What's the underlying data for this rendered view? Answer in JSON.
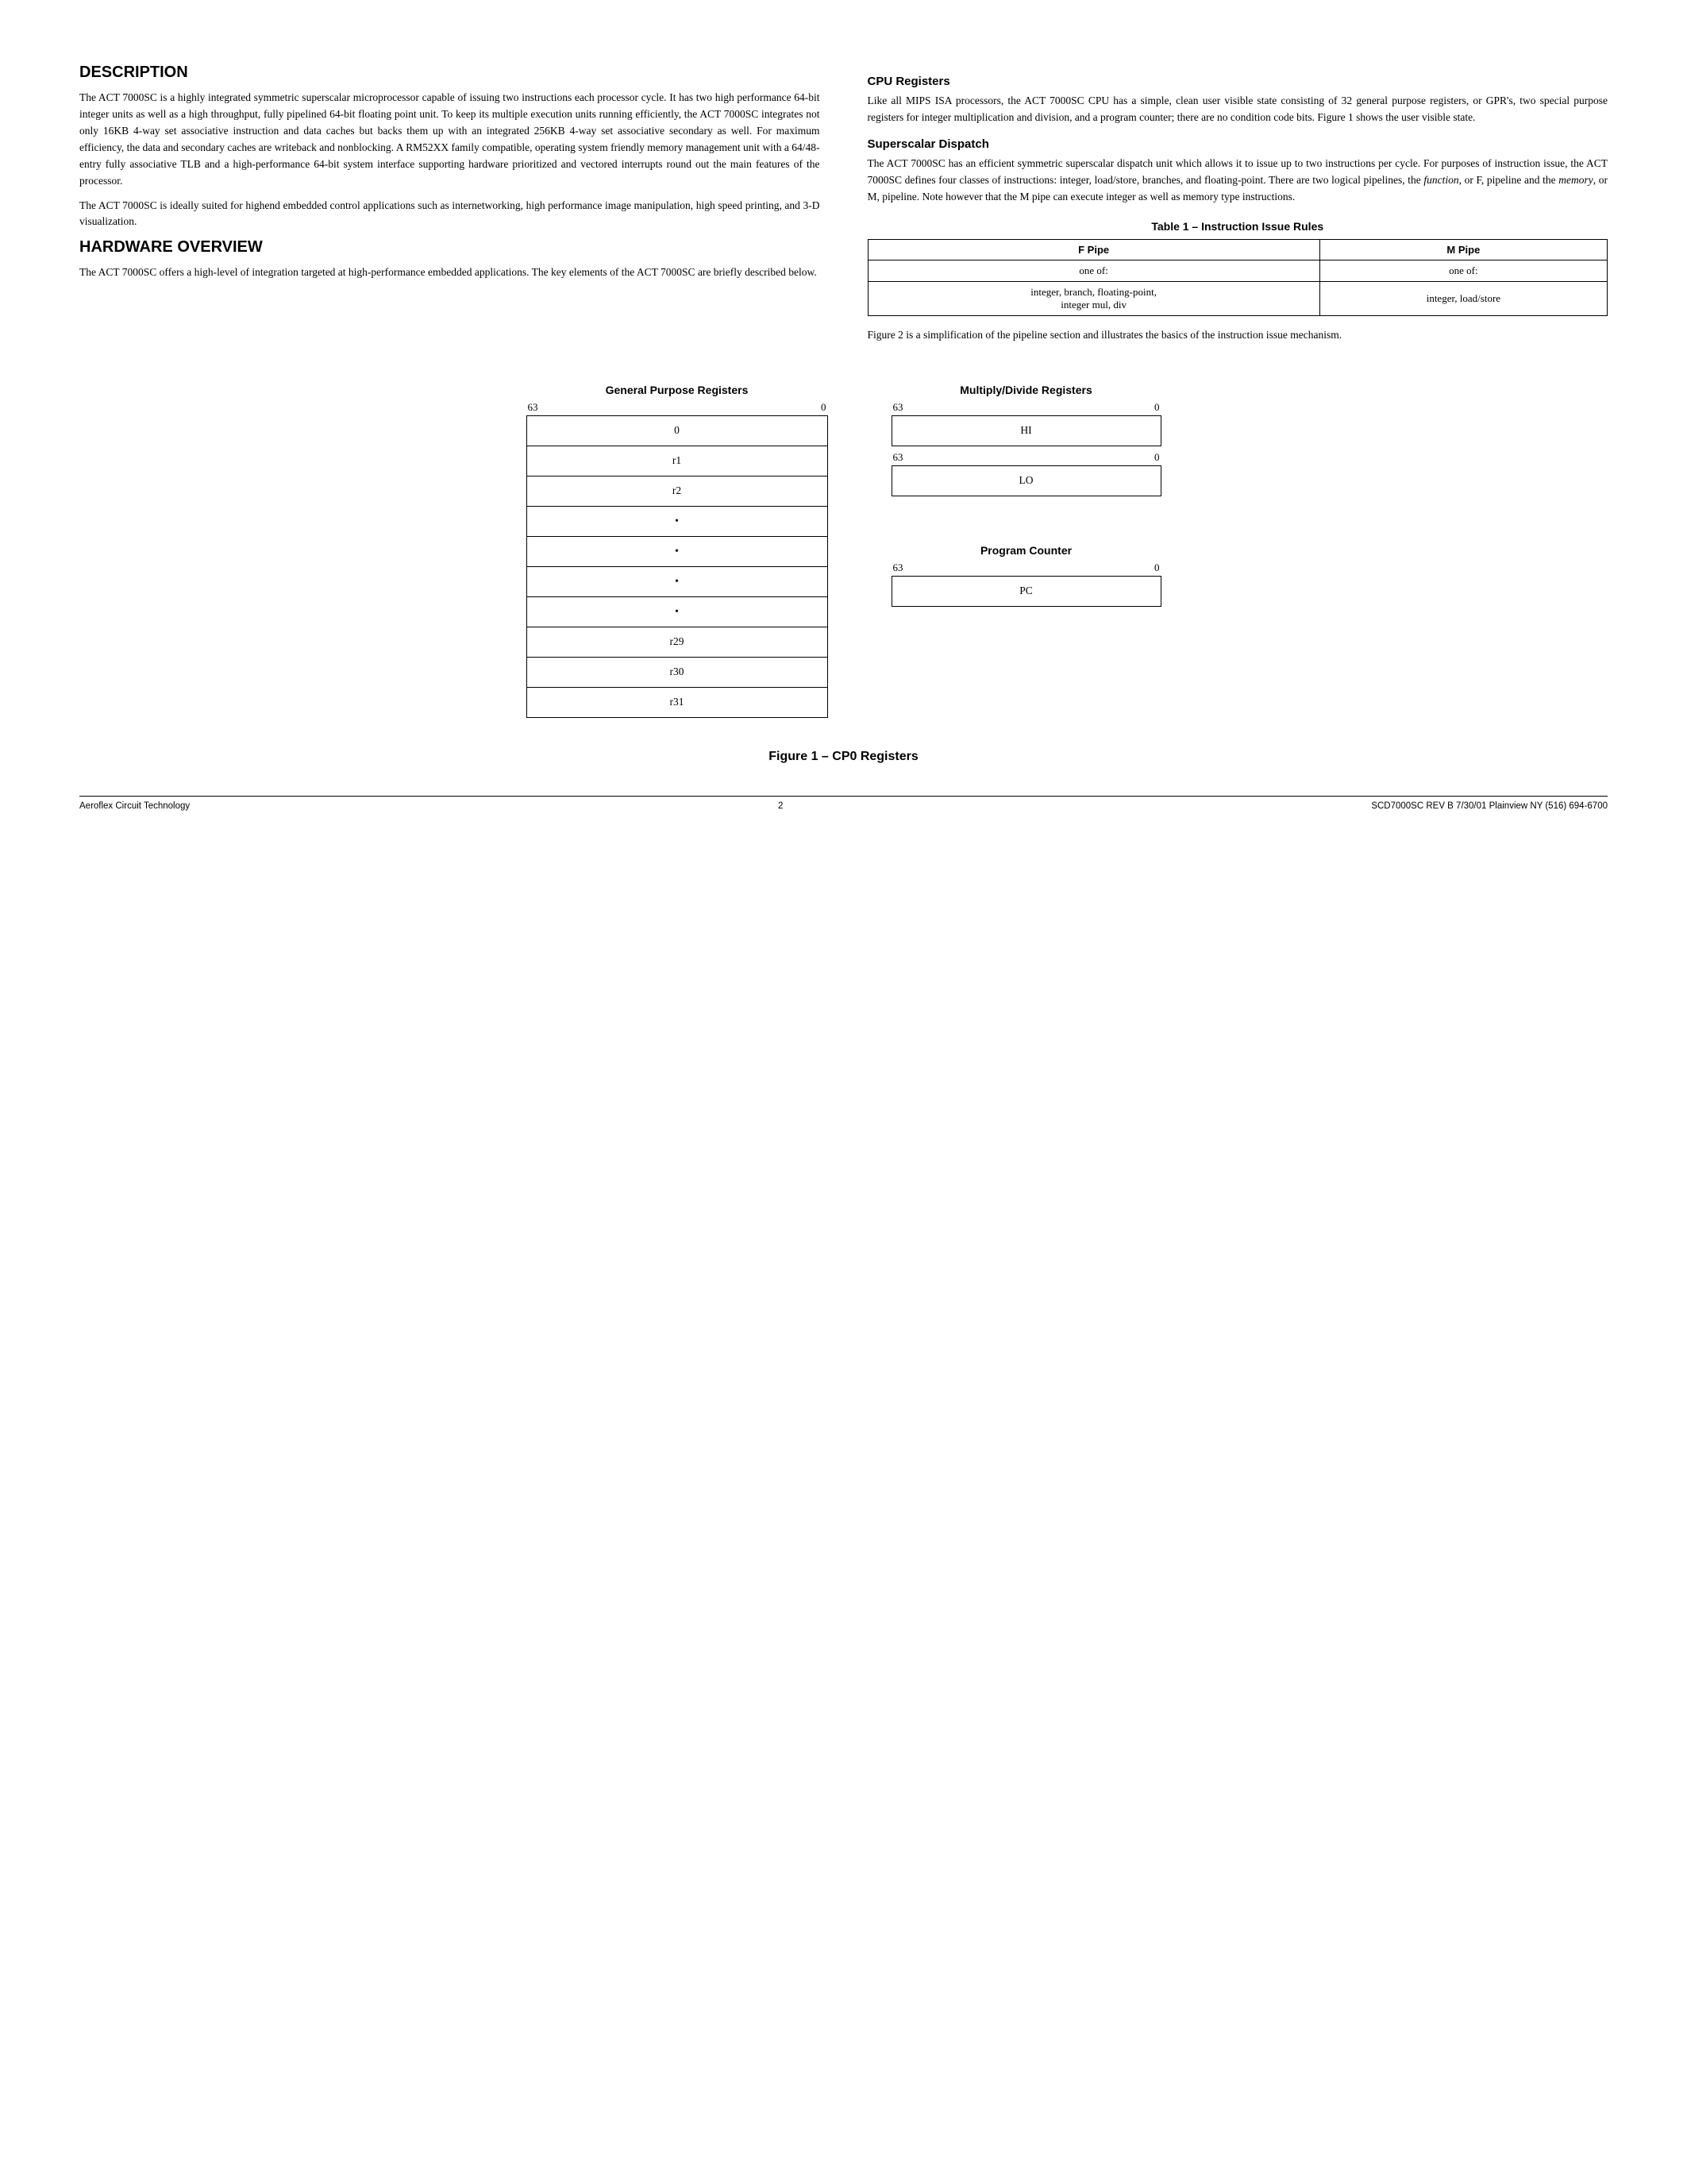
{
  "page": {
    "sections": {
      "description": {
        "title": "DESCRIPTION",
        "paragraphs": [
          "The ACT 7000SC is a highly integrated symmetric superscalar microprocessor capable of issuing two instructions each processor cycle. It has two high performance 64-bit integer units as well as a high throughput, fully pipelined 64-bit floating point unit. To keep its multiple execution units running efficiently, the ACT 7000SC integrates not only 16KB 4-way set associative instruction and data caches but backs them up with an integrated 256KB 4-way set associative secondary as well. For maximum efficiency, the data and secondary caches are writeback and nonblocking. A RM52XX family compatible, operating system friendly memory management unit with a 64/48-entry fully associative TLB and a high-performance 64-bit system interface supporting hardware prioritized and vectored interrupts round out the main features of the processor.",
          "The ACT 7000SC is ideally suited for highend embedded control applications such as internetworking, high performance image manipulation, high speed printing, and 3-D visualization."
        ]
      },
      "hardware_overview": {
        "title": "HARDWARE OVERVIEW",
        "paragraphs": [
          "The ACT 7000SC offers a high-level of integration targeted at high-performance embedded applications. The key elements of the ACT 7000SC are briefly described below."
        ]
      },
      "cpu_registers": {
        "title": "CPU Registers",
        "paragraphs": [
          "Like all MIPS ISA processors, the ACT 7000SC CPU has a simple, clean user visible state consisting of 32 general purpose registers, or GPR's, two special purpose registers for integer multiplication and division, and a program counter; there are no condition code bits. Figure 1 shows the user visible state."
        ]
      },
      "superscalar_dispatch": {
        "title": "Superscalar Dispatch",
        "paragraphs": [
          "The ACT 7000SC has an efficient symmetric superscalar dispatch unit which allows it to issue up to two instructions per cycle. For purposes of instruction issue, the ACT 7000SC defines four classes of instructions: integer, load/store, branches, and floating-point. There are two logical pipelines, the function, or F, pipeline and the memory, or M, pipeline. Note however that the M pipe can execute integer as well as memory type instructions."
        ]
      },
      "table": {
        "title": "Table 1 – Instruction Issue Rules",
        "headers": [
          "F Pipe",
          "M Pipe"
        ],
        "rows": [
          [
            "one of:",
            "one of:"
          ],
          [
            "integer, branch, floating-point,\ninteger mul, div",
            "integer, load/store"
          ]
        ]
      },
      "figure_caption_text": "Figure 2 is a simplification of the pipeline section and illustrates the basics of the instruction issue mechanism.",
      "diagrams": {
        "gpr": {
          "title": "General Purpose Registers",
          "bit_high": "63",
          "bit_low": "0",
          "rows": [
            "0",
            "r1",
            "r2",
            "•",
            "•",
            "•",
            "•",
            "r29",
            "r30",
            "r31"
          ]
        },
        "multiply_divide": {
          "title": "Multiply/Divide Registers",
          "registers": [
            {
              "bit_high": "63",
              "bit_low": "0",
              "label": "HI"
            },
            {
              "bit_high": "63",
              "bit_low": "0",
              "label": "LO"
            }
          ]
        },
        "program_counter": {
          "title": "Program Counter",
          "bit_high": "63",
          "bit_low": "0",
          "label": "PC"
        }
      },
      "figure_main_caption": "Figure 1 – CP0 Registers"
    },
    "footer": {
      "left": "Aeroflex Circuit Technology",
      "page_number": "2",
      "right": "SCD7000SC REV B  7/30/01  Plainview NY (516) 694-6700"
    }
  }
}
